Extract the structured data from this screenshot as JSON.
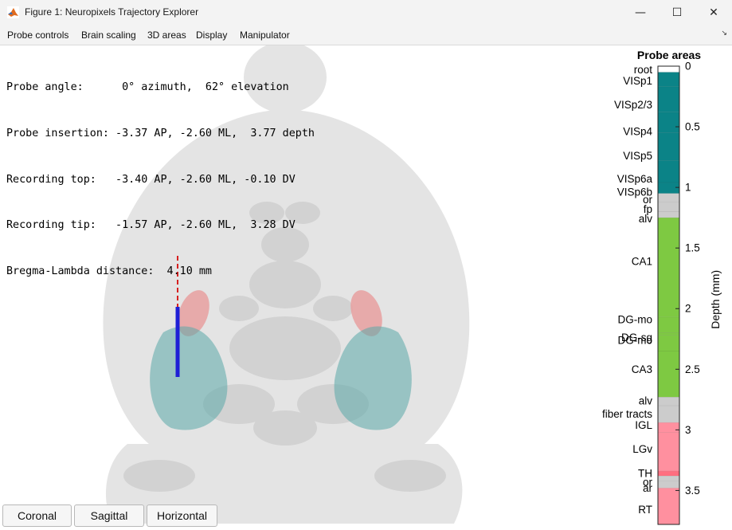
{
  "window": {
    "title": "Figure 1: Neuropixels Trajectory Explorer",
    "minimize_glyph": "—",
    "maximize_glyph": "☐",
    "close_glyph": "✕"
  },
  "menu": {
    "items": [
      {
        "label": "Probe controls"
      },
      {
        "label": "Brain scaling"
      },
      {
        "label": "3D areas"
      },
      {
        "label": "Display"
      },
      {
        "label": "Manipulator"
      }
    ],
    "dock_glyph": "↘"
  },
  "info": {
    "lines": [
      "Probe angle:      0° azimuth,  62° elevation",
      "Probe insertion: -3.37 AP, -2.60 ML,  3.77 depth",
      "Recording top:   -3.40 AP, -2.60 ML, -0.10 DV",
      "Recording tip:   -1.57 AP, -2.60 ML,  3.28 DV",
      "Bregma-Lambda distance:  4.10 mm"
    ]
  },
  "view_buttons": [
    {
      "label": "Coronal"
    },
    {
      "label": "Sagittal"
    },
    {
      "label": "Horizontal"
    }
  ],
  "colors": {
    "brain": "#e4e4e4",
    "isocortex": "#0b8387",
    "fiber": "#cccccc",
    "hippocampus": "#7ec942",
    "thalamus": "#ff909f",
    "probe_recording": "#1f1fd6",
    "probe_trajectory": "#d62020",
    "highlight_pink": "#e8a0a0",
    "highlight_teal": "#5aa8a8"
  },
  "chart_data": {
    "type": "bar",
    "title": "Probe areas",
    "ylabel": "Depth (mm)",
    "ylim": [
      0,
      3.78
    ],
    "yticks": [
      0,
      0.5,
      1,
      1.5,
      2,
      2.5,
      3,
      3.5
    ],
    "ytick_labels": [
      "0",
      "0.5",
      "1",
      "1.5",
      "2",
      "2.5",
      "3",
      "3.5"
    ],
    "segments": [
      {
        "name": "root",
        "start": 0.0,
        "end": 0.05,
        "label_at": 0.03,
        "color": "#ffffff"
      },
      {
        "name": "VISp1",
        "start": 0.05,
        "end": 0.17,
        "label_at": 0.12,
        "color": "#0b8387"
      },
      {
        "name": "VISp2/3",
        "start": 0.17,
        "end": 0.38,
        "label_at": 0.32,
        "color": "#0b8387"
      },
      {
        "name": "VISp4",
        "start": 0.38,
        "end": 0.55,
        "label_at": 0.54,
        "color": "#0b8387"
      },
      {
        "name": "VISp5",
        "start": 0.55,
        "end": 0.78,
        "label_at": 0.74,
        "color": "#0b8387"
      },
      {
        "name": "VISp6a",
        "start": 0.78,
        "end": 0.96,
        "label_at": 0.93,
        "color": "#0b8387"
      },
      {
        "name": "VISp6b",
        "start": 0.96,
        "end": 1.05,
        "label_at": 1.04,
        "color": "#0b8387"
      },
      {
        "name": "or",
        "start": 1.05,
        "end": 1.12,
        "label_at": 1.1,
        "color": "#cccccc"
      },
      {
        "name": "fp",
        "start": 1.12,
        "end": 1.2,
        "label_at": 1.18,
        "color": "#cccccc"
      },
      {
        "name": "alv",
        "start": 1.2,
        "end": 1.25,
        "label_at": 1.26,
        "color": "#cccccc"
      },
      {
        "name": "CA1",
        "start": 1.25,
        "end": 2.07,
        "label_at": 1.61,
        "color": "#7ec942"
      },
      {
        "name": "DG-mo",
        "start": 2.07,
        "end": 2.2,
        "label_at": 2.09,
        "color": "#7ec942"
      },
      {
        "name": "DG-sg",
        "start": 2.2,
        "end": 2.22,
        "label_at": 2.24,
        "color": "#7ec942"
      },
      {
        "name": "DG-mo",
        "start": 2.22,
        "end": 2.35,
        "label_at": 2.26,
        "color": "#7ec942"
      },
      {
        "name": "CA3",
        "start": 2.35,
        "end": 2.73,
        "label_at": 2.5,
        "color": "#7ec942"
      },
      {
        "name": "alv",
        "start": 2.73,
        "end": 2.8,
        "label_at": 2.76,
        "color": "#cccccc"
      },
      {
        "name": "fiber tracts",
        "start": 2.8,
        "end": 2.94,
        "label_at": 2.87,
        "color": "#cccccc"
      },
      {
        "name": "IGL",
        "start": 2.94,
        "end": 3.02,
        "label_at": 2.96,
        "color": "#ff909f"
      },
      {
        "name": "LGv",
        "start": 3.02,
        "end": 3.34,
        "label_at": 3.16,
        "color": "#ff909f"
      },
      {
        "name": "TH",
        "start": 3.34,
        "end": 3.38,
        "label_at": 3.36,
        "color": "#ff6f80"
      },
      {
        "name": "or",
        "start": 3.38,
        "end": 3.42,
        "label_at": 3.43,
        "color": "#cccccc"
      },
      {
        "name": "ar",
        "start": 3.42,
        "end": 3.48,
        "label_at": 3.48,
        "color": "#cccccc"
      },
      {
        "name": "RT",
        "start": 3.48,
        "end": 3.78,
        "label_at": 3.66,
        "color": "#ff909f"
      }
    ]
  }
}
